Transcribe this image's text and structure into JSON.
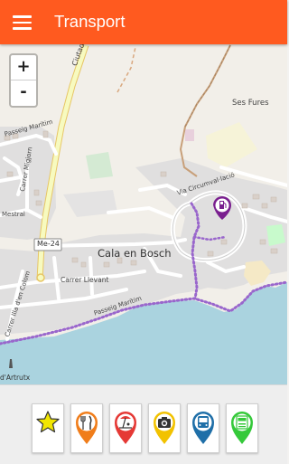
{
  "appbar": {
    "title": "Transport",
    "menu_icon": "hamburger-menu-icon",
    "color": "#ff5a1f"
  },
  "map": {
    "zoom_in_label": "+",
    "zoom_out_label": "-",
    "town_label": "Cala en Bosch",
    "place_ses_fures": "Ses Fures",
    "street_passeig_maritim_top": "Passeig Marítim",
    "street_carrer_migjorn": "Carrer Migjorn",
    "street_mestral": "Mestral",
    "road_shield": "Me-24",
    "street_carrer_llevant": "Carrer Llevant",
    "street_passeig_maritim_bottom": "Passeig Marítim",
    "street_carrer_illa": "Carrer Illa d'en Colom",
    "street_via_circumval": "Via Circumval·lació",
    "street_ciutadella": "Ciutadella",
    "place_artrutx": "d'Artrutx",
    "marker_icon": "fuel-station-marker-icon"
  },
  "categories": [
    {
      "name": "favorites",
      "icon": "star-icon",
      "color": "#f2e600"
    },
    {
      "name": "restaurants",
      "icon": "fork-knife-icon",
      "color": "#f07d1a"
    },
    {
      "name": "beaches",
      "icon": "beach-icon",
      "color": "#e53935"
    },
    {
      "name": "photo",
      "icon": "camera-icon",
      "color": "#f2c200"
    },
    {
      "name": "transport",
      "icon": "bus-icon",
      "color": "#1f6fa8"
    },
    {
      "name": "atm",
      "icon": "atm-icon",
      "color": "#35c93a"
    }
  ]
}
